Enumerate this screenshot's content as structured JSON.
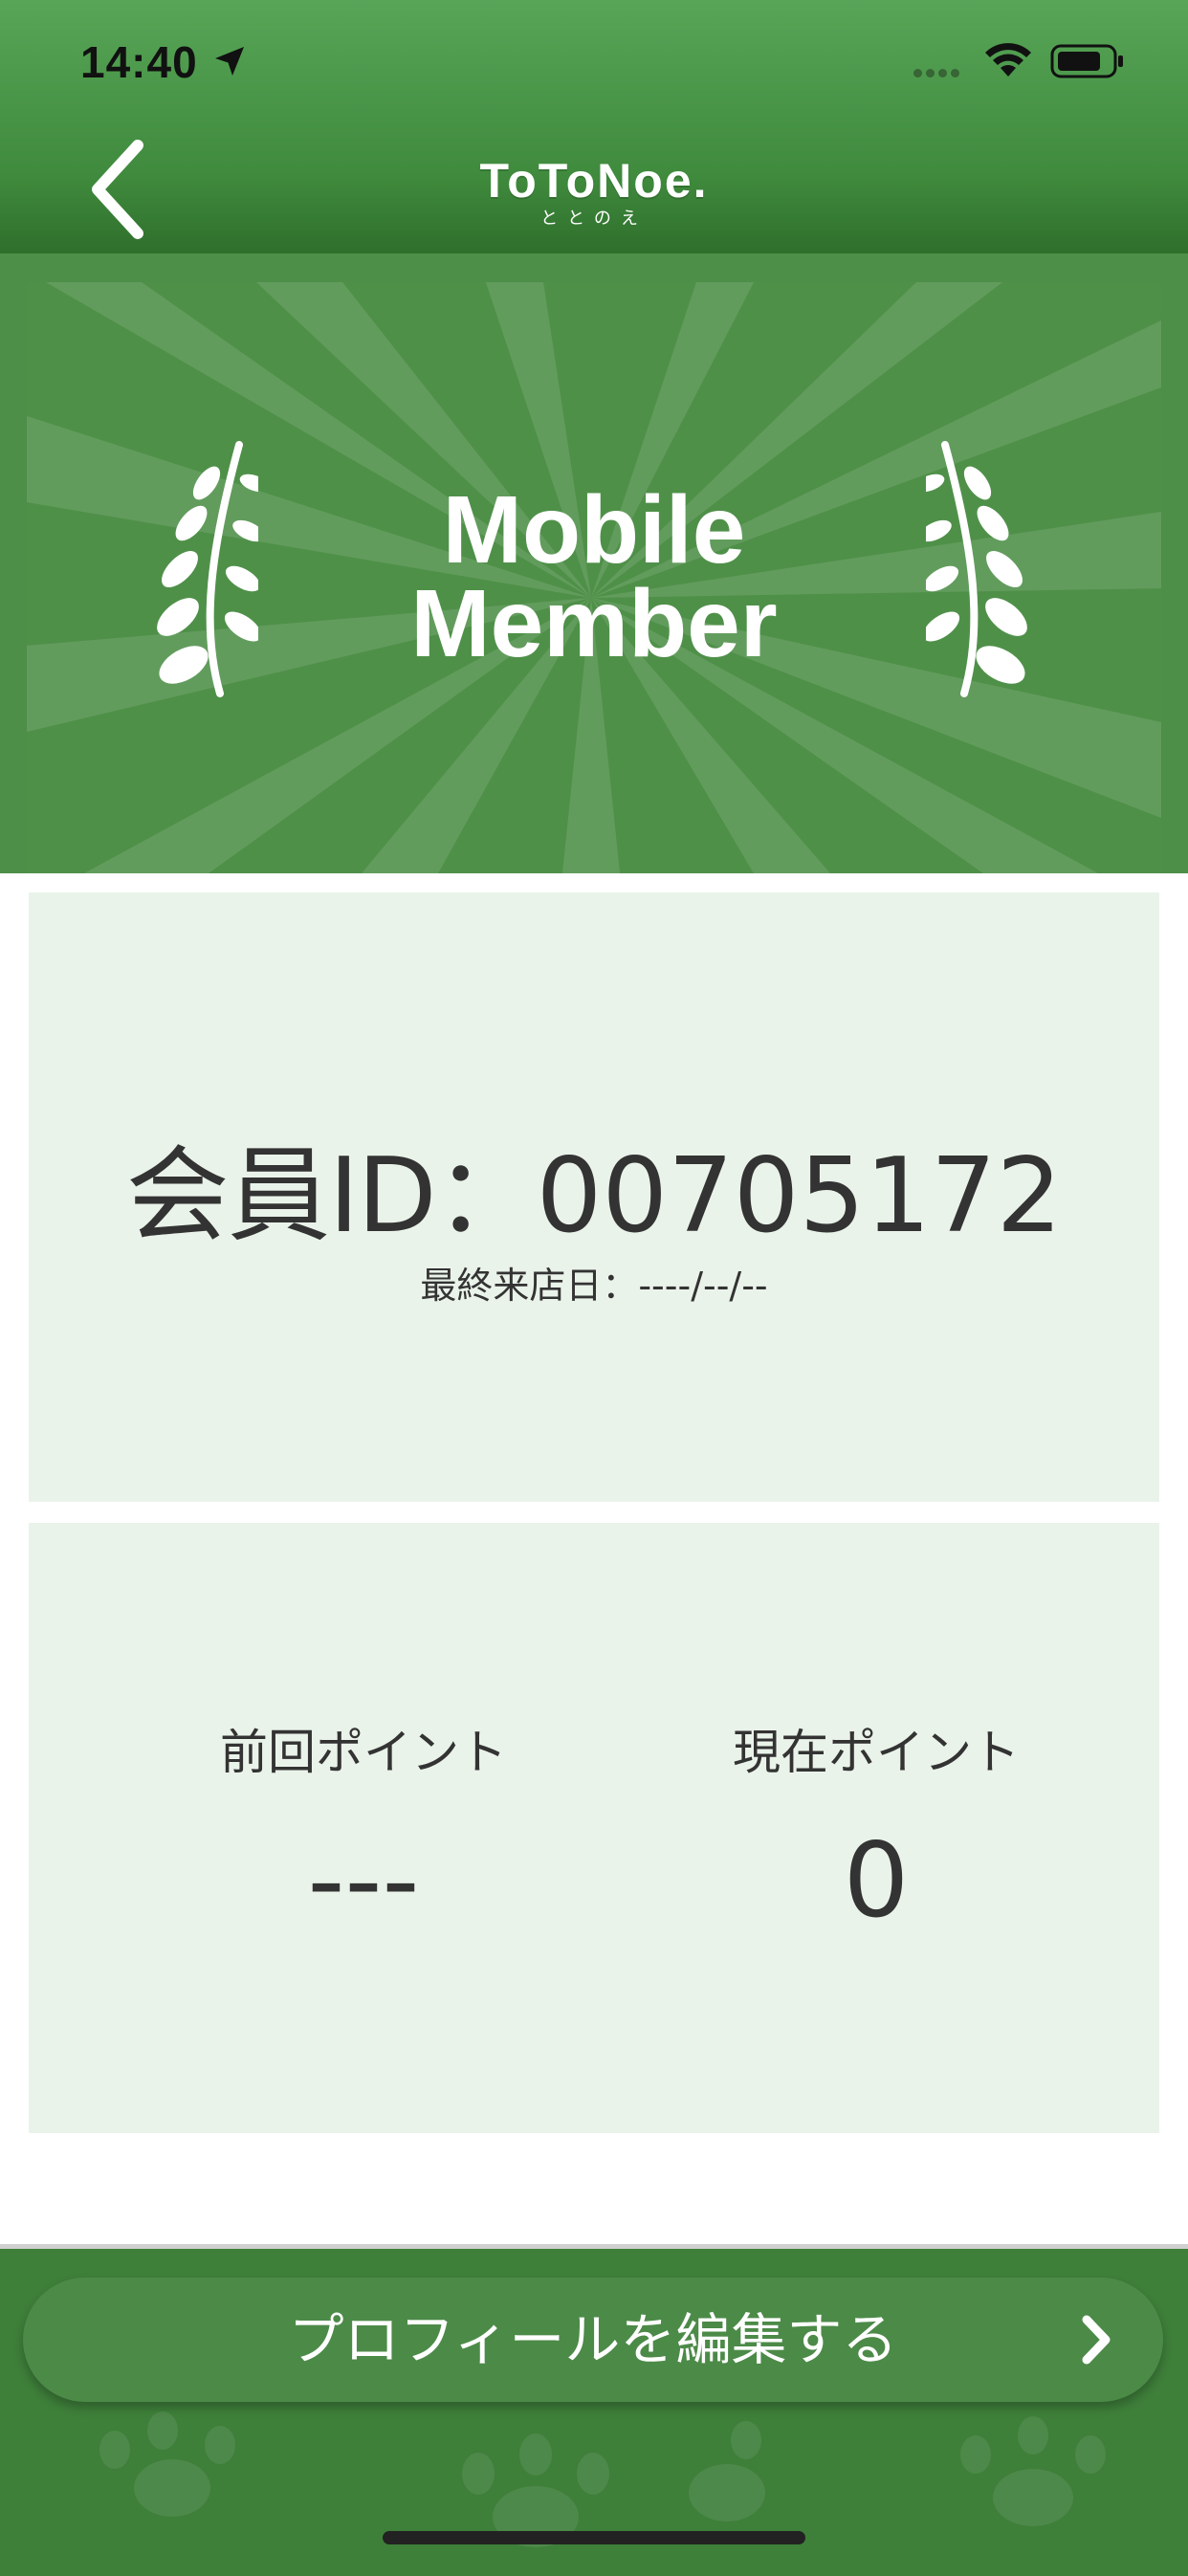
{
  "status_bar": {
    "time": "14:40"
  },
  "nav": {
    "logo_text": "ToToNoe.",
    "logo_sub": "ととのえ"
  },
  "banner": {
    "title_line1": "Mobile",
    "title_line2": "Member"
  },
  "member": {
    "id_label": "会員ID：",
    "id_value": "00705172",
    "last_visit_label": "最終来店日：",
    "last_visit_value": "----/--/--"
  },
  "points": {
    "previous_label": "前回ポイント",
    "previous_value": "---",
    "current_label": "現在ポイント",
    "current_value": "0"
  },
  "footer": {
    "edit_profile_label": "プロフィールを編集する"
  },
  "colors": {
    "primary_green": "#4f9049",
    "card_bg": "#eaf3ea",
    "text": "#333333"
  }
}
